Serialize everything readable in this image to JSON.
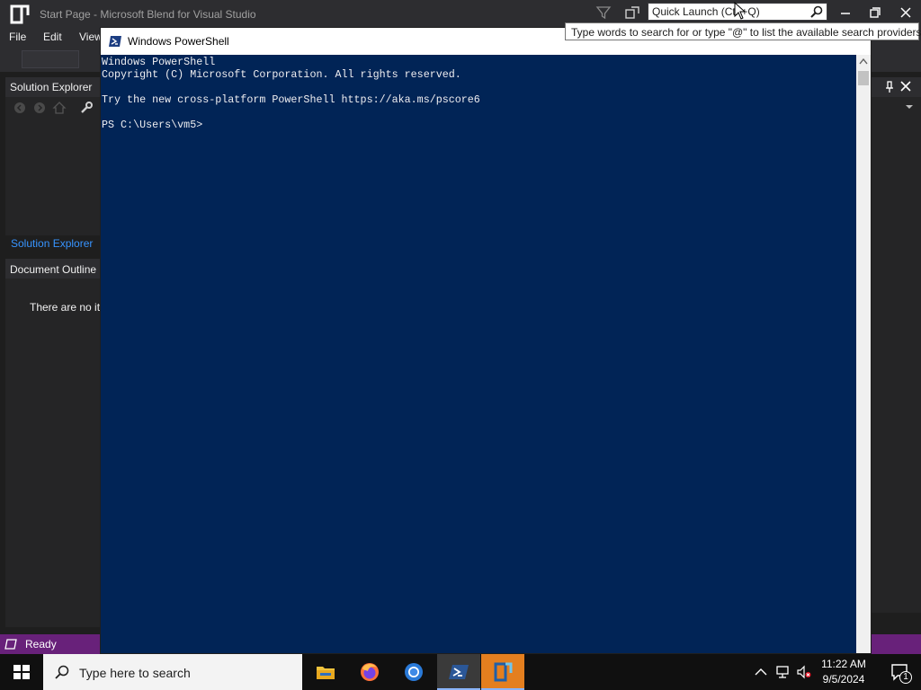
{
  "blend": {
    "title": "Start Page - Microsoft Blend for Visual Studio",
    "quick_launch_placeholder": "Quick Launch (Ctrl+Q)",
    "menu": [
      "File",
      "Edit",
      "View"
    ],
    "solution_explorer": {
      "title": "Solution Explorer",
      "tab_label": "Solution Explorer"
    },
    "document_outline": {
      "title": "Document Outline",
      "empty_text": "There are no ite"
    },
    "status": "Ready",
    "accent_color": "#68217a"
  },
  "tooltip": {
    "text": "Type words to search for or type \"@\" to list the available search providers"
  },
  "powershell": {
    "title": "Windows PowerShell",
    "console_lines": [
      "Windows PowerShell",
      "Copyright (C) Microsoft Corporation. All rights reserved.",
      "",
      "Try the new cross-platform PowerShell https://aka.ms/pscore6",
      "",
      "PS C:\\Users\\vm5>"
    ],
    "background_color": "#012456"
  },
  "taskbar": {
    "search_placeholder": "Type here to search",
    "apps": [
      "file-explorer",
      "firefox",
      "chrome",
      "powershell",
      "blend"
    ],
    "clock_time": "11:22 AM",
    "clock_date": "9/5/2024",
    "notification_count": "1"
  }
}
